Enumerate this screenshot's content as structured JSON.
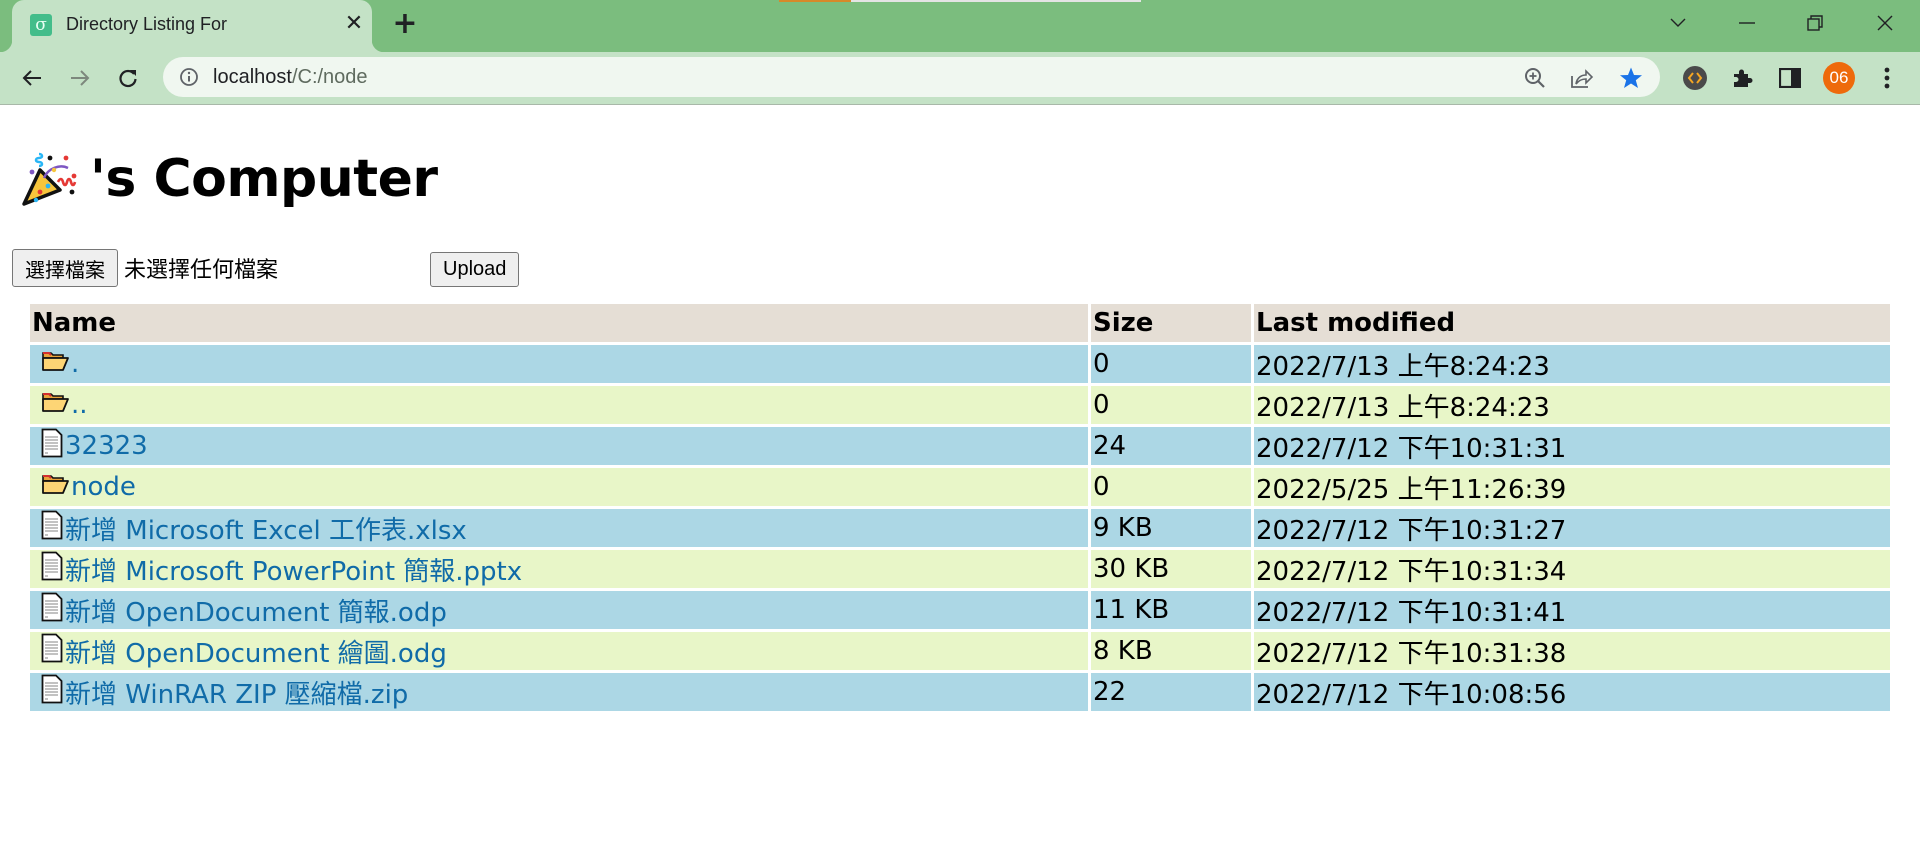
{
  "browser": {
    "tab": {
      "title": "Directory Listing For",
      "favicon": "sigma-favicon-icon",
      "close_icon": "close-icon"
    },
    "new_tab_icon": "plus-icon",
    "window_controls": [
      "tab-search-chevron-icon",
      "minimize-icon",
      "restore-icon",
      "close-window-icon"
    ],
    "address": {
      "host": "localhost",
      "path": "/C:/node",
      "site_info_icon": "info-icon"
    },
    "omnibox_icons": [
      "zoom-icon",
      "share-icon",
      "bookmark-star-icon"
    ],
    "extensions": [
      "code-extension-icon",
      "puzzle-extensions-icon",
      "side-panel-icon"
    ],
    "profile_label": "06",
    "menu_icon": "kebab-menu-icon",
    "colors": {
      "titlebar": "#7bbd7e",
      "toolbar": "#c4e2c6",
      "profile": "#ee6a0b",
      "star": "#1a73e8"
    }
  },
  "page": {
    "heading_emoji": "party-popper-icon",
    "heading": "'s Computer",
    "file_input": {
      "button_label": "選擇檔案",
      "status": "未選擇任何檔案"
    },
    "upload_label": "Upload",
    "table": {
      "columns": [
        "Name",
        "Size",
        "Last modified"
      ],
      "rows": [
        {
          "type": "folder",
          "name": ".",
          "size": "0",
          "modified": "2022/7/13 上午8:24:23"
        },
        {
          "type": "folder",
          "name": "..",
          "size": "0",
          "modified": "2022/7/13 上午8:24:23"
        },
        {
          "type": "file",
          "name": "32323",
          "size": "24",
          "modified": "2022/7/12 下午10:31:31"
        },
        {
          "type": "folder",
          "name": "node",
          "size": "0",
          "modified": "2022/5/25 上午11:26:39"
        },
        {
          "type": "file",
          "name": "新增 Microsoft Excel 工作表.xlsx",
          "size": "9 KB",
          "modified": "2022/7/12 下午10:31:27"
        },
        {
          "type": "file",
          "name": "新增 Microsoft PowerPoint 簡報.pptx",
          "size": "30 KB",
          "modified": "2022/7/12 下午10:31:34"
        },
        {
          "type": "file",
          "name": "新增 OpenDocument 簡報.odp",
          "size": "11 KB",
          "modified": "2022/7/12 下午10:31:41"
        },
        {
          "type": "file",
          "name": "新增 OpenDocument 繪圖.odg",
          "size": "8 KB",
          "modified": "2022/7/12 下午10:31:38"
        },
        {
          "type": "file",
          "name": "新增 WinRAR ZIP 壓縮檔.zip",
          "size": "22",
          "modified": "2022/7/12 下午10:08:56"
        }
      ],
      "colors": {
        "header": "#e5ded5",
        "row_odd": "#acd7e5",
        "row_even": "#e8f6c8",
        "link": "#106ba8"
      }
    }
  }
}
